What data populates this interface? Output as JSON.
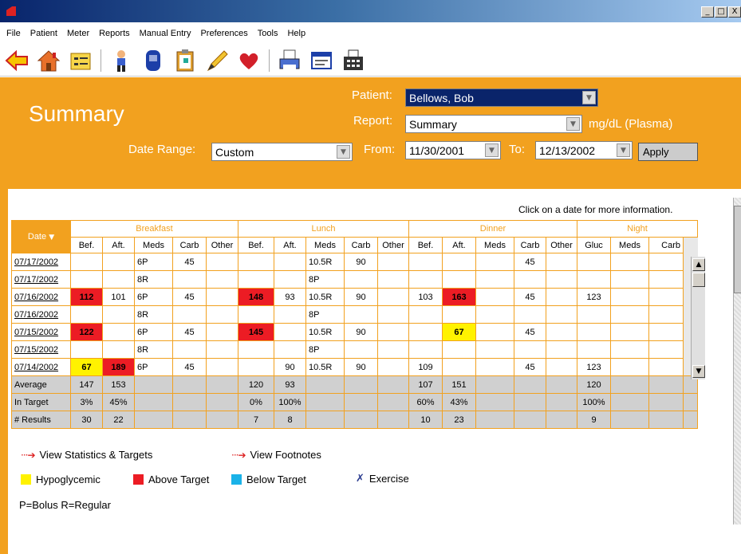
{
  "menu": [
    "File",
    "Patient",
    "Meter",
    "Reports",
    "Manual Entry",
    "Preferences",
    "Tools",
    "Help"
  ],
  "window_buttons": [
    "_",
    "□",
    "X"
  ],
  "toolbar_icons": [
    "back-arrow-icon",
    "home-icon",
    "patient-list-icon",
    "person-icon",
    "meter-icon",
    "clipboard-icon",
    "pencil-icon",
    "heart-icon",
    "print-icon",
    "report-card-icon",
    "fax-icon"
  ],
  "header": {
    "title": "Summary",
    "patient_label": "Patient:",
    "patient_value": "Bellows, Bob",
    "report_label": "Report:",
    "report_value": "Summary",
    "units": "mg/dL (Plasma)",
    "date_range_label": "Date Range:",
    "date_range_value": "Custom",
    "from_label": "From:",
    "from_value": "11/30/2001",
    "to_label": "To:",
    "to_value": "12/13/2002",
    "apply_label": "Apply"
  },
  "hint": "Click on a date for more information.",
  "table": {
    "date_header": "Date",
    "groups": [
      "Breakfast",
      "Lunch",
      "Dinner",
      "Night"
    ],
    "subheaders": [
      "Bef.",
      "Aft.",
      "Meds",
      "Carb",
      "Other",
      "Bef.",
      "Aft.",
      "Meds",
      "Carb",
      "Other",
      "Bef.",
      "Aft.",
      "Meds",
      "Carb",
      "Other",
      "Gluc",
      "Meds",
      "Carb"
    ],
    "rows": [
      {
        "date": "07/17/2002",
        "cells": [
          "",
          "",
          "6P",
          "45",
          "",
          "",
          "",
          "10.5R",
          "90",
          "",
          "",
          "",
          "",
          "45",
          "",
          "",
          "",
          ""
        ],
        "flags": {}
      },
      {
        "date": "07/17/2002",
        "cells": [
          "",
          "",
          "8R",
          "",
          "",
          "",
          "",
          "8P",
          "",
          "",
          "",
          "",
          "",
          "",
          "",
          "",
          "",
          ""
        ],
        "flags": {}
      },
      {
        "date": "07/16/2002",
        "cells": [
          "112",
          "101",
          "6P",
          "45",
          "",
          "148",
          "93",
          "10.5R",
          "90",
          "",
          "103",
          "163",
          "",
          "45",
          "",
          "123",
          "",
          ""
        ],
        "flags": {
          "0": "red",
          "5": "red",
          "11": "red"
        }
      },
      {
        "date": "07/16/2002",
        "cells": [
          "",
          "",
          "8R",
          "",
          "",
          "",
          "",
          "8P",
          "",
          "",
          "",
          "",
          "",
          "",
          "",
          "",
          "",
          ""
        ],
        "flags": {}
      },
      {
        "date": "07/15/2002",
        "cells": [
          "122",
          "",
          "6P",
          "45",
          "",
          "145",
          "",
          "10.5R",
          "90",
          "",
          "",
          "67",
          "",
          "45",
          "",
          "",
          "",
          ""
        ],
        "flags": {
          "0": "red",
          "5": "red",
          "11": "yel"
        }
      },
      {
        "date": "07/15/2002",
        "cells": [
          "",
          "",
          "8R",
          "",
          "",
          "",
          "",
          "8P",
          "",
          "",
          "",
          "",
          "",
          "",
          "",
          "",
          "",
          ""
        ],
        "flags": {}
      },
      {
        "date": "07/14/2002",
        "cells": [
          "67",
          "189",
          "6P",
          "45",
          "",
          "",
          "90",
          "10.5R",
          "90",
          "",
          "109",
          "",
          "",
          "45",
          "",
          "123",
          "",
          ""
        ],
        "flags": {
          "0": "yel",
          "1": "red"
        }
      }
    ],
    "summary": [
      {
        "label": "Average",
        "cells": [
          "147",
          "153",
          "",
          "",
          "",
          "120",
          "93",
          "",
          "",
          "",
          "107",
          "151",
          "",
          "",
          "",
          "120",
          "",
          ""
        ]
      },
      {
        "label": "In Target",
        "cells": [
          "3%",
          "45%",
          "",
          "",
          "",
          "0%",
          "100%",
          "",
          "",
          "",
          "60%",
          "43%",
          "",
          "",
          "",
          "100%",
          "",
          ""
        ]
      },
      {
        "label": "# Results",
        "cells": [
          "30",
          "22",
          "",
          "",
          "",
          "7",
          "8",
          "",
          "",
          "",
          "10",
          "23",
          "",
          "",
          "",
          "9",
          "",
          ""
        ]
      }
    ]
  },
  "colors": {
    "orange": "#f2a11f",
    "red": "#ec1c24",
    "yellow": "#fff200",
    "blue": "#1ab2e8",
    "navy": "#2a3b8f"
  },
  "legend": {
    "view_stats": "View Statistics & Targets",
    "view_footnotes": "View Footnotes",
    "hypo": "Hypoglycemic",
    "above": "Above Target",
    "below": "Below Target",
    "exercise": "Exercise",
    "abbrev": "P=Bolus  R=Regular"
  }
}
